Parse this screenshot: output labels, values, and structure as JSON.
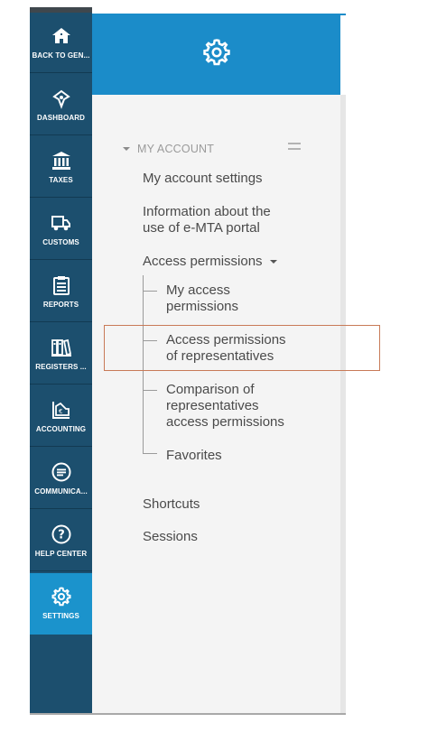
{
  "nav": {
    "items": [
      {
        "label": "BACK TO GEN...",
        "icon": "home-icon"
      },
      {
        "label": "DASHBOARD",
        "icon": "dashboard-icon"
      },
      {
        "label": "TAXES",
        "icon": "bank-icon"
      },
      {
        "label": "CUSTOMS",
        "icon": "truck-icon"
      },
      {
        "label": "REPORTS",
        "icon": "clipboard-icon"
      },
      {
        "label": "REGISTERS ...",
        "icon": "books-icon"
      },
      {
        "label": "ACCOUNTING",
        "icon": "ledger-icon"
      },
      {
        "label": "COMMUNICA...",
        "icon": "chat-icon"
      },
      {
        "label": "HELP CENTER",
        "icon": "help-icon"
      },
      {
        "label": "SETTINGS",
        "icon": "gear-icon",
        "active": true
      }
    ]
  },
  "colors": {
    "nav_bg": "#1c4f6e",
    "accent": "#1b93cc",
    "header": "#1b8cc9",
    "panel_bg": "#f4f4f4",
    "highlight_border": "#c87a57"
  },
  "menu": {
    "section": "MY ACCOUNT",
    "account_settings": "My account settings",
    "info_line1": "Information about the",
    "info_line2": "use of e-MTA portal",
    "access_permissions": "Access permissions",
    "sub": {
      "my_access_1": "My access",
      "my_access_2": "permissions",
      "rep_1": "Access permissions",
      "rep_2": "of representatives",
      "cmp_1": "Comparison of",
      "cmp_2": "representatives",
      "cmp_3": "access permissions",
      "favorites": "Favorites"
    },
    "shortcuts": "Shortcuts",
    "sessions": "Sessions"
  }
}
